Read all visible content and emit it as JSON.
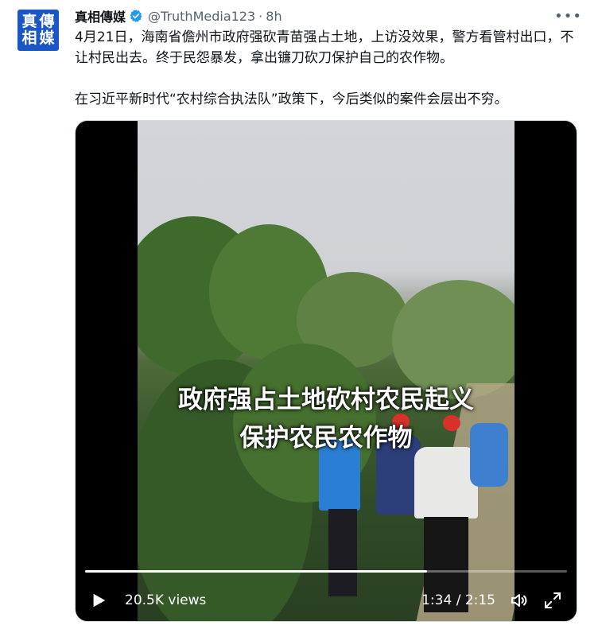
{
  "tweet": {
    "avatar_chars": [
      "真",
      "傳",
      "相",
      "媒"
    ],
    "author_name": "真相傳媒",
    "handle": "@TruthMedia123",
    "separator": "·",
    "time": "8h",
    "more_icon": "more-icon",
    "paragraph1": "4月21日，海南省儋州市政府强砍青苗强占土地，上访没效果，警方看管村出口，不让村民出去。终于民怨暴发，拿出镰刀砍刀保护自己的农作物。",
    "paragraph2": "在习近平新时代“农村综合执法队”政策下，今后类似的案件会层出不穷。"
  },
  "video": {
    "overlay_line1": "政府强占土地砍村农民起义",
    "overlay_line2": "保护农民农作物",
    "views": "20.5K views",
    "time_display": "1:34 / 2:15",
    "progress": 0.71,
    "icons": [
      "play-icon",
      "volume-icon",
      "fullscreen-icon"
    ]
  },
  "colors": {
    "avatar_bg": "#1a56c4",
    "verified": "#1d9bf0",
    "secondary_text": "#536471"
  }
}
